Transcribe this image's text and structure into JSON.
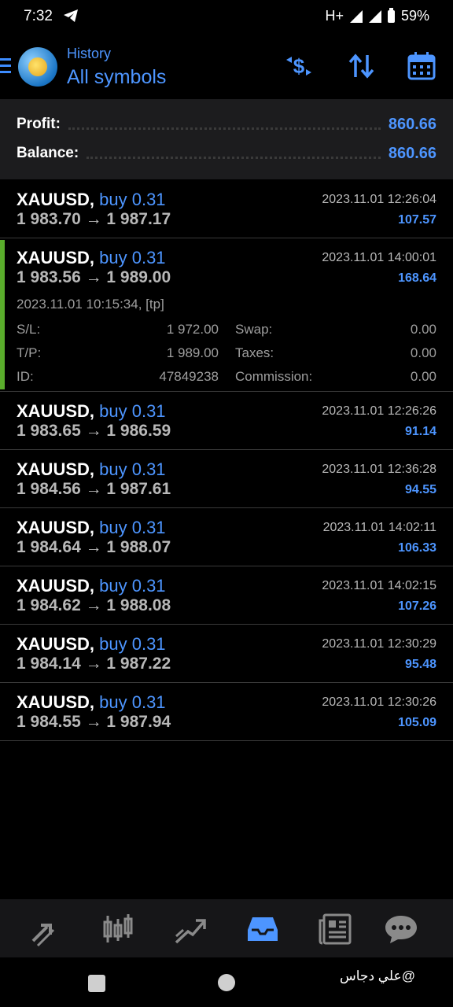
{
  "status": {
    "time": "7:32",
    "signal": "H+",
    "battery": "59%"
  },
  "header": {
    "subtitle": "History",
    "title": "All symbols"
  },
  "summary": {
    "profit_label": "Profit:",
    "profit_value": "860.66",
    "balance_label": "Balance:",
    "balance_value": "860.66"
  },
  "deals": [
    {
      "symbol": "XAUUSD,",
      "type": "buy 0.31",
      "prices": "1 983.70 → 1 987.17",
      "time": "2023.11.01 12:26:04",
      "profit": "107.57"
    },
    {
      "symbol": "XAUUSD,",
      "type": "buy 0.31",
      "prices": "1 983.56 → 1 989.00",
      "time": "2023.11.01 14:00:01",
      "profit": "168.64",
      "details": {
        "open": "2023.11.01 10:15:34, [tp]",
        "sl_label": "S/L:",
        "sl": "1 972.00",
        "tp_label": "T/P:",
        "tp": "1 989.00",
        "id_label": "ID:",
        "id": "47849238",
        "swap_label": "Swap:",
        "swap": "0.00",
        "taxes_label": "Taxes:",
        "taxes": "0.00",
        "commission_label": "Commission:",
        "commission": "0.00"
      }
    },
    {
      "symbol": "XAUUSD,",
      "type": "buy 0.31",
      "prices": "1 983.65 → 1 986.59",
      "time": "2023.11.01 12:26:26",
      "profit": "91.14"
    },
    {
      "symbol": "XAUUSD,",
      "type": "buy 0.31",
      "prices": "1 984.56 → 1 987.61",
      "time": "2023.11.01 12:36:28",
      "profit": "94.55"
    },
    {
      "symbol": "XAUUSD,",
      "type": "buy 0.31",
      "prices": "1 984.64 → 1 988.07",
      "time": "2023.11.01 14:02:11",
      "profit": "106.33"
    },
    {
      "symbol": "XAUUSD,",
      "type": "buy 0.31",
      "prices": "1 984.62 → 1 988.08",
      "time": "2023.11.01 14:02:15",
      "profit": "107.26"
    },
    {
      "symbol": "XAUUSD,",
      "type": "buy 0.31",
      "prices": "1 984.14 → 1 987.22",
      "time": "2023.11.01 12:30:29",
      "profit": "95.48"
    },
    {
      "symbol": "XAUUSD,",
      "type": "buy 0.31",
      "prices": "1 984.55 → 1 987.94",
      "time": "2023.11.01 12:30:26",
      "profit": "105.09"
    }
  ],
  "bottom_nav": [
    "quotes-icon",
    "chart-icon",
    "trade-icon",
    "history-icon",
    "news-icon",
    "chat-icon"
  ],
  "watermark": "علي دجاس@",
  "colors": {
    "accent": "#4d95ff",
    "expanded_bar": "#5aad2c"
  }
}
